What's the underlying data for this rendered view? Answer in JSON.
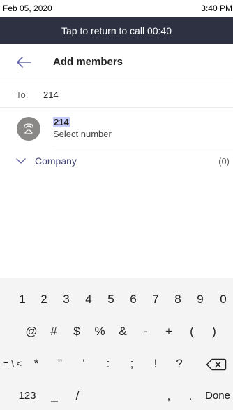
{
  "status": {
    "date": "Feb 05, 2020",
    "time": "3:40 PM"
  },
  "call_banner": {
    "text": "Tap to return to call 00:40"
  },
  "header": {
    "title": "Add members",
    "back_icon": "arrow-left-icon"
  },
  "to": {
    "label": "To:",
    "value": "214"
  },
  "contact": {
    "number": "214",
    "subtitle": "Select number",
    "avatar_icon": "phone-handset-icon"
  },
  "group": {
    "label": "Company",
    "count": "(0)"
  },
  "keyboard": {
    "row1": [
      "1",
      "2",
      "3",
      "4",
      "5",
      "6",
      "7",
      "8",
      "9",
      "0"
    ],
    "row2": [
      "@",
      "#",
      "$",
      "%",
      "&",
      "-",
      "+",
      "(",
      ")"
    ],
    "row3": [
      "= \\ <",
      "*",
      "\"",
      "'",
      ":",
      ";",
      "!",
      "?",
      "backspace"
    ],
    "row4": [
      "123",
      "_",
      "/",
      "space",
      ",",
      ".",
      "Done"
    ]
  },
  "colors": {
    "banner": "#2d3142",
    "accent": "#6264a7",
    "group_text": "#464775",
    "avatar": "#8a8886",
    "highlight": "#c5cbfa"
  }
}
